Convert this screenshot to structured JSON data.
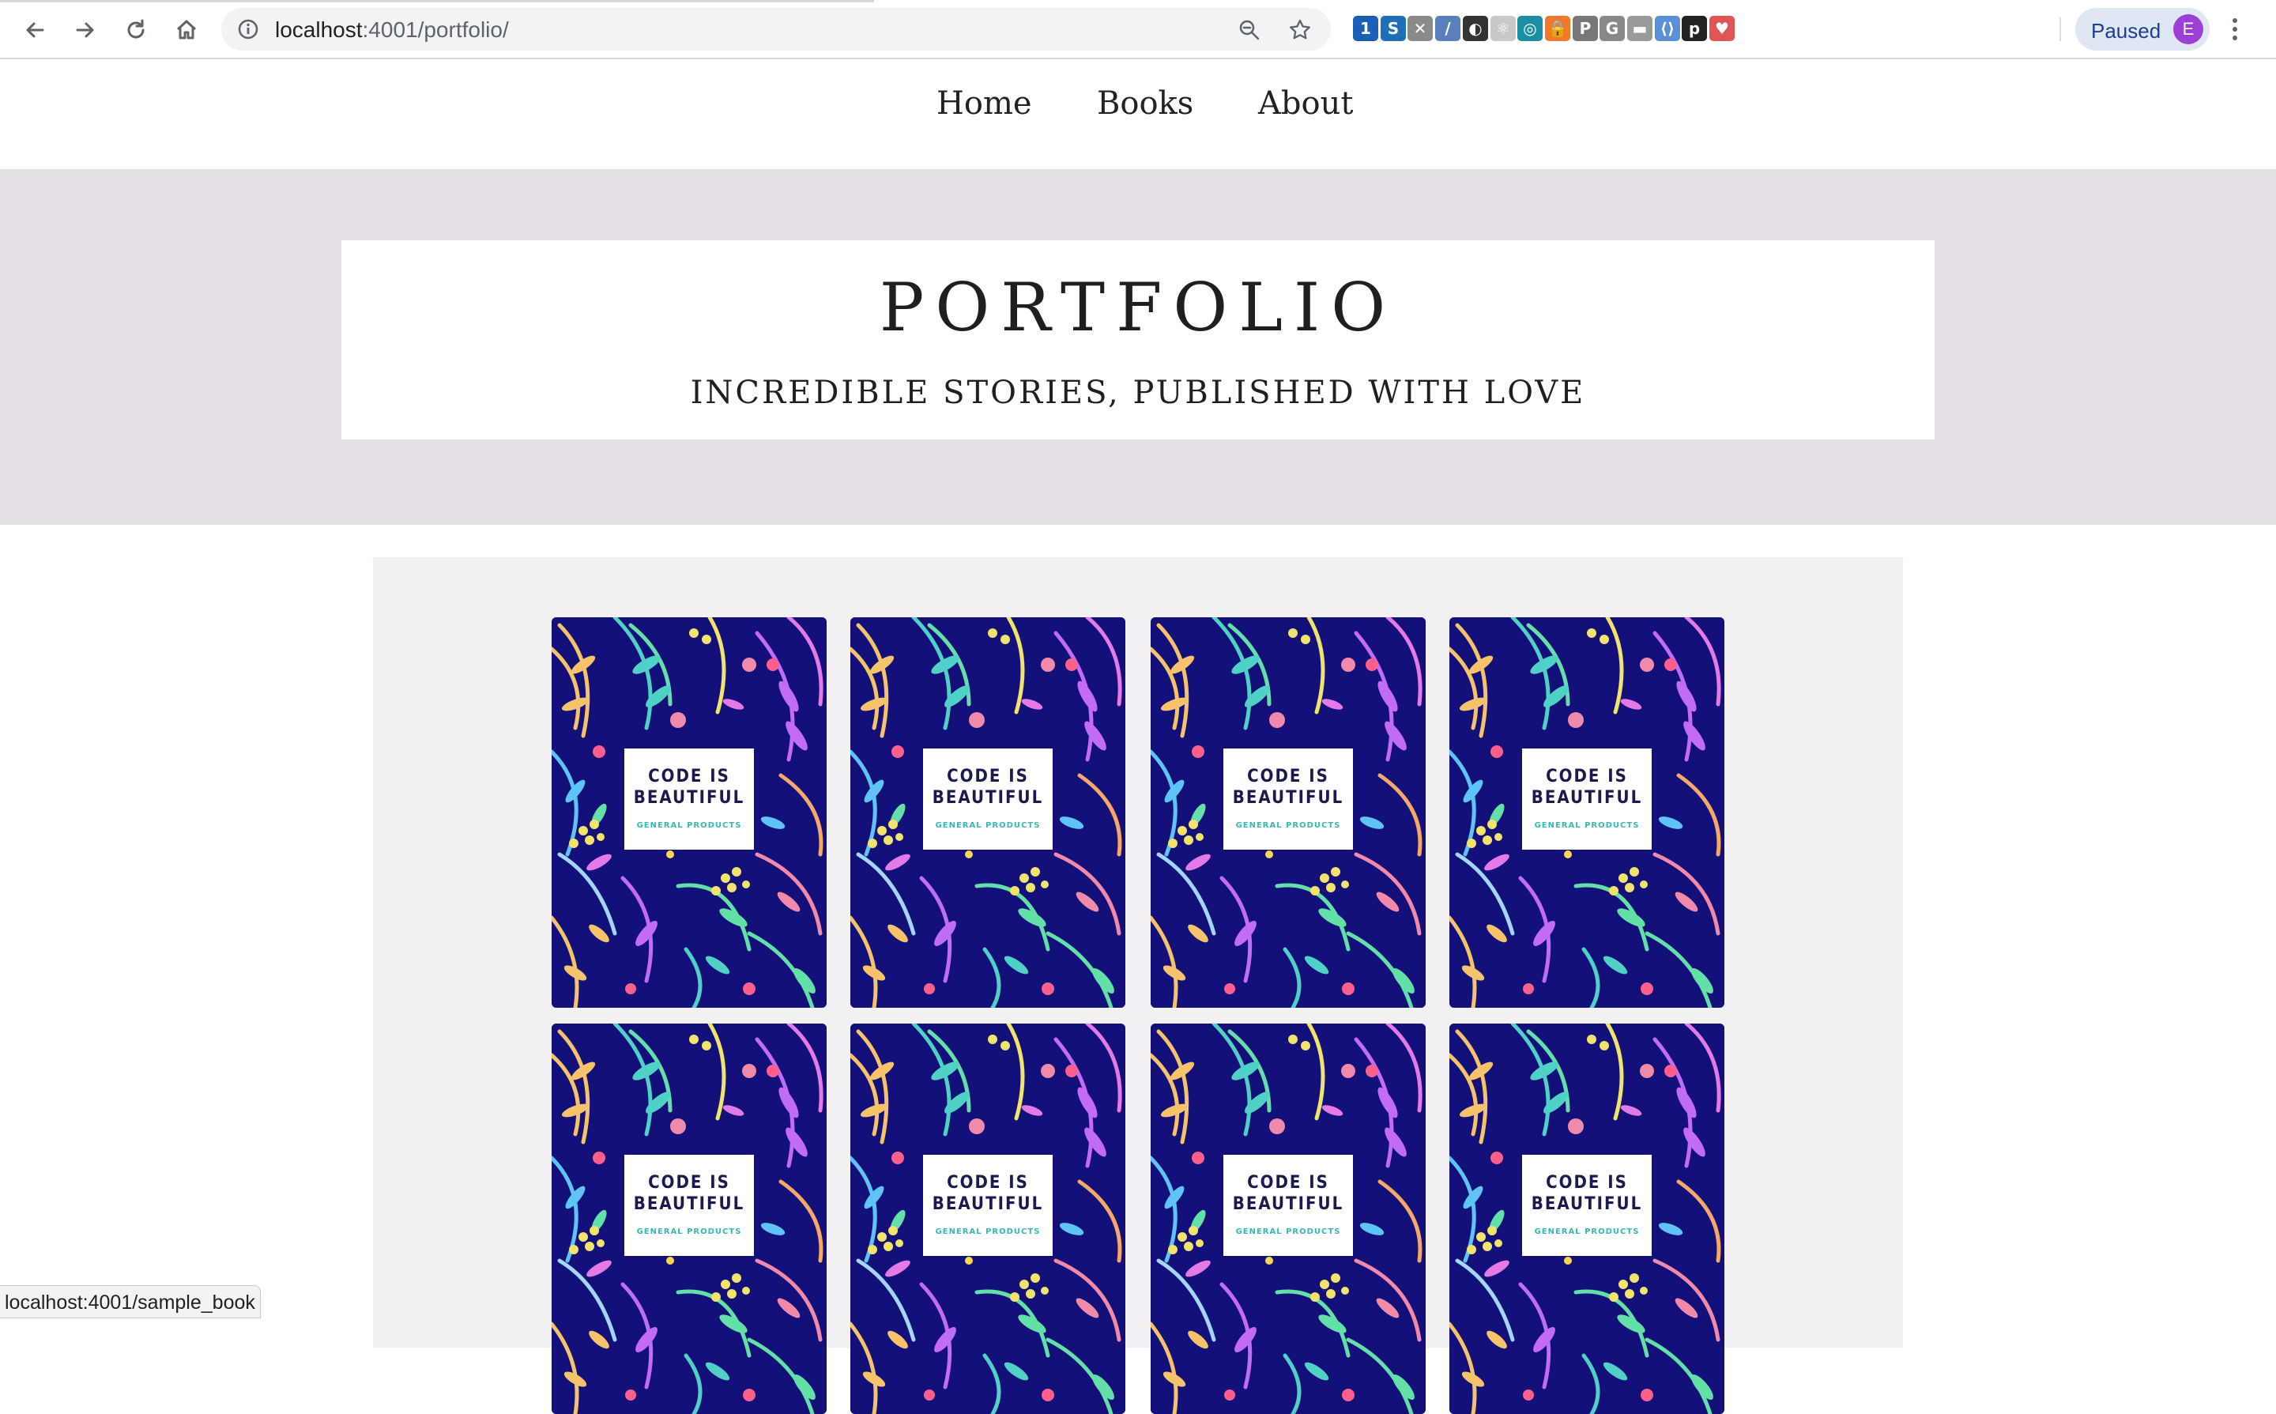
{
  "browser": {
    "url_host": "localhost",
    "url_path": ":4001/portfolio/",
    "profile_label": "Paused",
    "profile_initial": "E",
    "status_url": "localhost:4001/sample_book",
    "extensions": [
      {
        "icon": "1password-icon",
        "color": "#1a5fb4",
        "glyph": "1"
      },
      {
        "icon": "s-extension-icon",
        "color": "#1f6fb8",
        "glyph": "S"
      },
      {
        "icon": "puzzle-icon",
        "color": "#8a8a8a",
        "glyph": "✕"
      },
      {
        "icon": "feather-icon",
        "color": "#5b7fbd",
        "glyph": "/"
      },
      {
        "icon": "dark-mode-icon",
        "color": "#333333",
        "glyph": "◐"
      },
      {
        "icon": "react-devtools-icon",
        "color": "#c8c8c8",
        "glyph": "⚛"
      },
      {
        "icon": "teal-extension-icon",
        "color": "#1a8fa3",
        "glyph": "◎"
      },
      {
        "icon": "lock-icon",
        "color": "#f07a2a",
        "glyph": "🔒"
      },
      {
        "icon": "p-extension-icon",
        "color": "#777777",
        "glyph": "P"
      },
      {
        "icon": "g-extension-icon",
        "color": "#888888",
        "glyph": "G"
      },
      {
        "icon": "window-icon",
        "color": "#9a9a9a",
        "glyph": "▬"
      },
      {
        "icon": "code-icon",
        "color": "#5b8fd6",
        "glyph": "⟨⟩"
      },
      {
        "icon": "pocket-p-icon",
        "color": "#222222",
        "glyph": "p"
      },
      {
        "icon": "shield-icon",
        "color": "#e25555",
        "glyph": "♥"
      }
    ]
  },
  "nav": {
    "items": [
      {
        "label": "Home"
      },
      {
        "label": "Books"
      },
      {
        "label": "About"
      }
    ]
  },
  "hero": {
    "title": "PORTFOLIO",
    "subtitle": "INCREDIBLE STORIES, PUBLISHED WITH LOVE"
  },
  "books": [
    {
      "title": "CODE IS\nBEAUTIFUL",
      "brand": "GENERAL PRODUCTS"
    },
    {
      "title": "CODE IS\nBEAUTIFUL",
      "brand": "GENERAL PRODUCTS"
    },
    {
      "title": "CODE IS\nBEAUTIFUL",
      "brand": "GENERAL PRODUCTS"
    },
    {
      "title": "CODE IS\nBEAUTIFUL",
      "brand": "GENERAL PRODUCTS"
    },
    {
      "title": "CODE IS\nBEAUTIFUL",
      "brand": "GENERAL PRODUCTS"
    },
    {
      "title": "CODE IS\nBEAUTIFUL",
      "brand": "GENERAL PRODUCTS"
    },
    {
      "title": "CODE IS\nBEAUTIFUL",
      "brand": "GENERAL PRODUCTS"
    },
    {
      "title": "CODE IS\nBEAUTIFUL",
      "brand": "GENERAL PRODUCTS"
    }
  ],
  "colors": {
    "hero_bg": "#e4e0e6",
    "grid_bg": "#f2f0f3",
    "cover_bg": "#14107a",
    "brand_text": "#36b8b5"
  }
}
